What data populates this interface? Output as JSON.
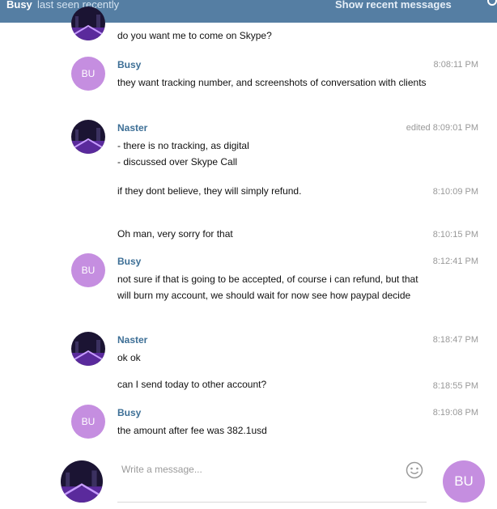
{
  "header": {
    "contact_name": "Busy",
    "status": "last seen recently",
    "recent_link": "Show recent messages",
    "search_icon": "search-icon"
  },
  "avatars": {
    "bu_initials": "BU",
    "naster_icon": "night-city-avatar"
  },
  "messages": [
    {
      "text": "do you want me to come on Skype?"
    },
    {
      "sender": "Busy",
      "time": "8:08:11 PM",
      "text": "they want tracking number, and screenshots of conversation with clients"
    },
    {
      "sender": "Naster",
      "time": "edited 8:09:01 PM",
      "text": "- there is no tracking, as digital\n- discussed over Skype Call"
    },
    {
      "time": "8:10:09 PM",
      "text": "if they dont believe, they will simply refund."
    },
    {
      "time": "8:10:15 PM",
      "text": "Oh man, very sorry for that"
    },
    {
      "sender": "Busy",
      "time": "8:12:41 PM",
      "text": "not sure if that is going to be accepted, of course i can refund, but that will burn my account, we should wait for now see how paypal decide"
    },
    {
      "sender": "Naster",
      "time": "8:18:47 PM",
      "text": "ok ok"
    },
    {
      "time": "8:18:55 PM",
      "text": "can I send today to other account?"
    },
    {
      "sender": "Busy",
      "time": "8:19:08 PM",
      "text": "the amount after fee was 382.1usd"
    }
  ],
  "composer": {
    "placeholder": "Write a message...",
    "emoji_icon": "smile-icon",
    "send_initials": "BU"
  }
}
